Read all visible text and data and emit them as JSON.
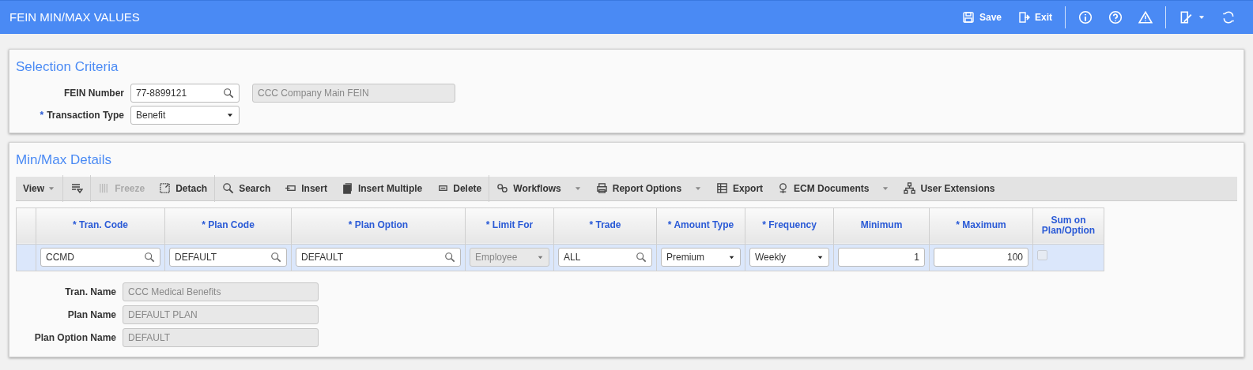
{
  "window": {
    "title": "FEIN MIN/MAX VALUES"
  },
  "header_actions": [
    {
      "label": "Save"
    },
    {
      "label": "Exit"
    }
  ],
  "selection_criteria": {
    "title": "Selection Criteria",
    "fields": [
      {
        "label": "FEIN Number",
        "kind": "lookup",
        "value": "77-8899121",
        "description": "CCC Company Main FEIN"
      },
      {
        "required_mark": "*",
        "label": "Transaction Type",
        "kind": "select",
        "value": "Benefit"
      }
    ]
  },
  "details": {
    "title": "Min/Max Details",
    "toolbar": [
      {
        "label": "View",
        "dropdown": true,
        "disabled": false
      },
      {
        "label": "Freeze",
        "dropdown": false,
        "disabled": true
      },
      {
        "label": "Detach",
        "dropdown": false,
        "disabled": false
      },
      {
        "label": "Search",
        "dropdown": false,
        "disabled": false
      },
      {
        "label": "Insert",
        "dropdown": false,
        "disabled": false
      },
      {
        "label": "Insert Multiple",
        "dropdown": false,
        "disabled": false
      },
      {
        "label": "Delete",
        "dropdown": false,
        "disabled": false
      },
      {
        "label": "Workflows",
        "dropdown": true,
        "disabled": false
      },
      {
        "label": "Report Options",
        "dropdown": true,
        "disabled": false
      },
      {
        "label": "Export",
        "dropdown": false,
        "disabled": false
      },
      {
        "label": "ECM Documents",
        "dropdown": true,
        "disabled": false
      },
      {
        "label": "User Extensions",
        "dropdown": false,
        "disabled": false
      }
    ],
    "table": {
      "columns": [
        {
          "label": "* Tran. Code"
        },
        {
          "label": "* Plan Code"
        },
        {
          "label": "* Plan Option"
        },
        {
          "label": "* Limit For"
        },
        {
          "label": "* Trade"
        },
        {
          "label": "* Amount Type"
        },
        {
          "label": "* Frequency"
        },
        {
          "label": "Minimum"
        },
        {
          "label": "* Maximum"
        },
        {
          "label": "Sum on Plan/Option"
        }
      ],
      "rows": [
        {
          "selected": true,
          "cells": [
            {
              "kind": "lookup",
              "value": "CCMD"
            },
            {
              "kind": "lookup",
              "value": "DEFAULT"
            },
            {
              "kind": "lookup",
              "value": "DEFAULT"
            },
            {
              "kind": "select",
              "value": "Employee",
              "disabled": true
            },
            {
              "kind": "lookup",
              "value": "ALL"
            },
            {
              "kind": "select",
              "value": "Premium",
              "disabled": false
            },
            {
              "kind": "select",
              "value": "Weekly",
              "disabled": false
            },
            {
              "kind": "number",
              "value": "1"
            },
            {
              "kind": "number",
              "value": "100"
            },
            {
              "kind": "checkbox",
              "checked": false,
              "disabled": true
            }
          ]
        }
      ]
    },
    "detail_fields": [
      {
        "label": "Tran. Name",
        "value": "CCC Medical Benefits"
      },
      {
        "label": "Plan Name",
        "value": "DEFAULT PLAN"
      },
      {
        "label": "Plan Option Name",
        "value": "DEFAULT"
      }
    ]
  }
}
